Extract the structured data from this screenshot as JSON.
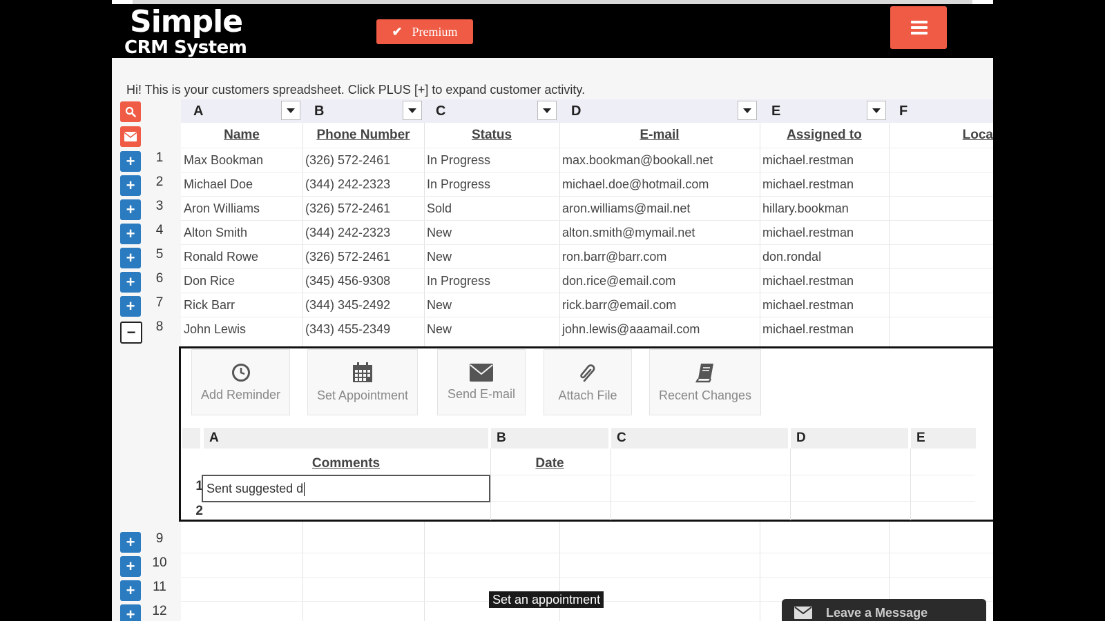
{
  "header": {
    "logo_line1": "Simple",
    "logo_line2": "CRM System",
    "premium_label": "Premium",
    "accent_color": "#ef5b45"
  },
  "notice": "Hi! This is your customers spreadsheet. Click PLUS [+] to expand customer activity.",
  "tools": [
    {
      "icon": "search-icon"
    },
    {
      "icon": "envelope-icon"
    }
  ],
  "columns": [
    {
      "letter": "A",
      "header": "Name"
    },
    {
      "letter": "B",
      "header": "Phone Number"
    },
    {
      "letter": "C",
      "header": "Status"
    },
    {
      "letter": "D",
      "header": "E-mail"
    },
    {
      "letter": "E",
      "header": "Assigned to"
    },
    {
      "letter": "F",
      "header": "Loca"
    }
  ],
  "rows": [
    {
      "num": "1",
      "name": "Max Bookman",
      "phone": "(326) 572-2461",
      "status": "In Progress",
      "email": "max.bookman@bookall.net",
      "assigned": "michael.restman"
    },
    {
      "num": "2",
      "name": "Michael Doe",
      "phone": "(344) 242-2323",
      "status": "In Progress",
      "email": "michael.doe@hotmail.com",
      "assigned": "michael.restman"
    },
    {
      "num": "3",
      "name": "Aron Williams",
      "phone": "(326) 572-2461",
      "status": "Sold",
      "email": "aron.williams@mail.net",
      "assigned": "hillary.bookman"
    },
    {
      "num": "4",
      "name": "Alton Smith",
      "phone": "(344) 242-2323",
      "status": "New",
      "email": "alton.smith@mymail.net",
      "assigned": "michael.restman"
    },
    {
      "num": "5",
      "name": "Ronald Rowe",
      "phone": "(326) 572-2461",
      "status": "New",
      "email": "ron.barr@barr.com",
      "assigned": "don.rondal"
    },
    {
      "num": "6",
      "name": "Don Rice",
      "phone": "(345) 456-9308",
      "status": "In Progress",
      "email": "don.rice@email.com",
      "assigned": "michael.restman"
    },
    {
      "num": "7",
      "name": "Rick Barr",
      "phone": "(344) 345-2492",
      "status": "New",
      "email": "rick.barr@email.com",
      "assigned": "michael.restman"
    },
    {
      "num": "8",
      "name": "John Lewis",
      "phone": "(343) 455-2349",
      "status": "New",
      "email": "john.lewis@aaamail.com",
      "assigned": "michael.restman"
    }
  ],
  "activity": {
    "actions": [
      {
        "label": "Add Reminder",
        "icon": "clock-icon"
      },
      {
        "label": "Set Appointment",
        "icon": "calendar-icon"
      },
      {
        "label": "Send E-mail",
        "icon": "envelope-icon"
      },
      {
        "label": "Attach File",
        "icon": "paperclip-icon"
      },
      {
        "label": "Recent Changes",
        "icon": "book-icon"
      }
    ],
    "sub_columns": [
      "A",
      "B",
      "C",
      "D",
      "E"
    ],
    "sub_headers": {
      "comments": "Comments",
      "date": "Date"
    },
    "sub_rows": [
      "1",
      "2"
    ],
    "editor_value": "Sent suggested d"
  },
  "empty_rows": [
    "9",
    "10",
    "11",
    "12"
  ],
  "tooltip": "Set an appointment",
  "chat_label": "Leave a Message"
}
